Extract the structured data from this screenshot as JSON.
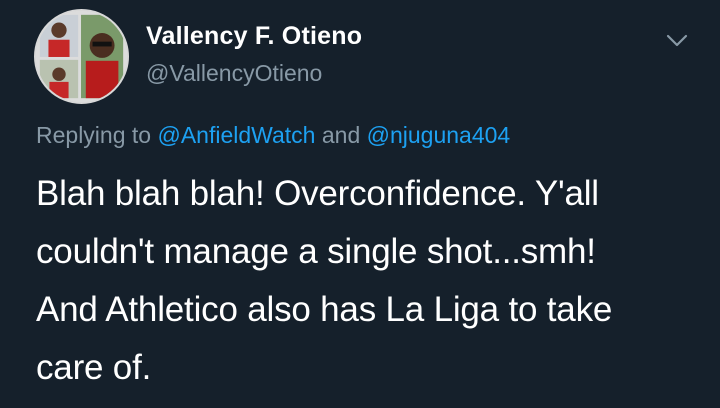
{
  "tweet": {
    "author_name": "Vallency F. Otieno",
    "author_handle": "@VallencyOtieno",
    "replying_prefix": "Replying to",
    "replying_mentions": [
      "@AnfieldWatch",
      "@njuguna404"
    ],
    "replying_joiner": "and",
    "body_lines": [
      "Blah blah blah! Overconfidence. Y'all",
      "couldn't manage a single shot...smh!",
      "And Athletico also has La Liga to take",
      "care of."
    ]
  },
  "icons": {
    "menu": "chevron-down-icon",
    "avatar": "avatar-collage"
  },
  "colors": {
    "background": "#15202b",
    "text_primary": "#ffffff",
    "text_secondary": "#8899a6",
    "link": "#1da1f2"
  }
}
